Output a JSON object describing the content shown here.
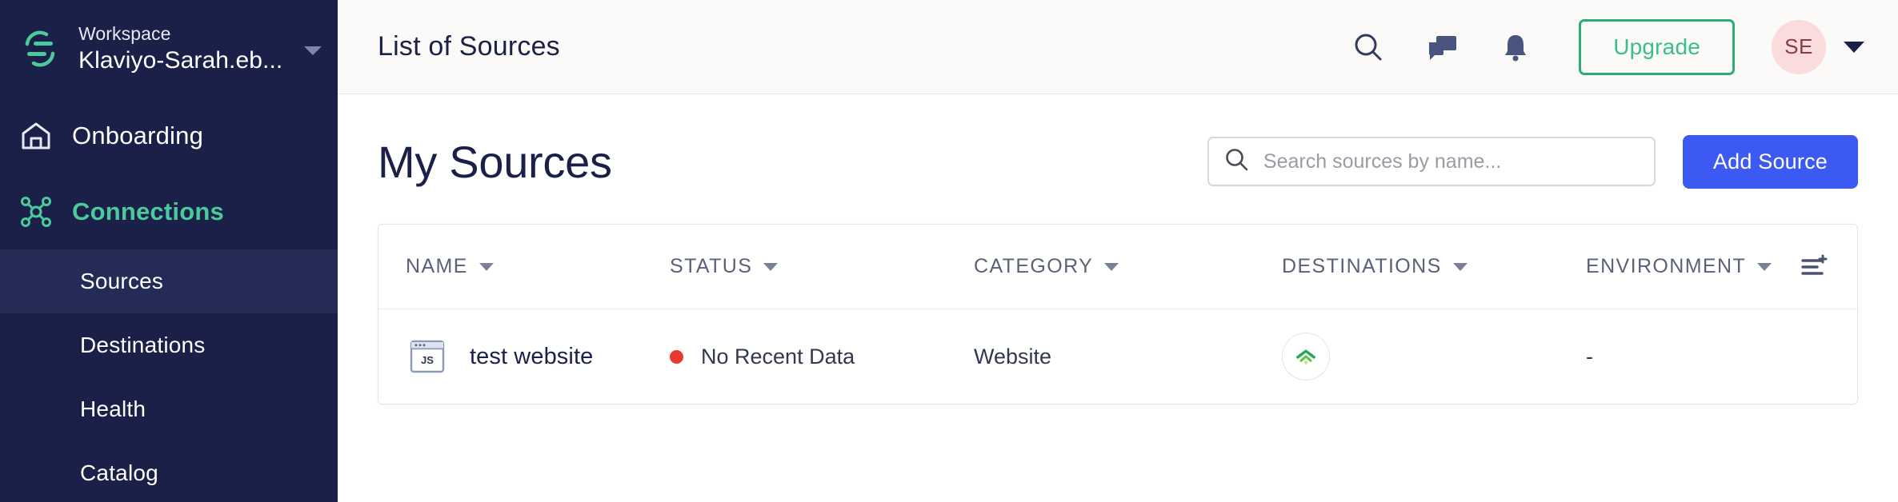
{
  "sidebar": {
    "logo_icon": "segment-logo-icon",
    "workspace_label": "Workspace",
    "workspace_name": "Klaviyo-Sarah.eb...",
    "workspace_caret_icon": "chevron-down-icon",
    "nav": [
      {
        "label": "Onboarding",
        "icon": "home-icon",
        "active": false
      },
      {
        "label": "Connections",
        "icon": "connections-node-icon",
        "active": true
      }
    ],
    "sub_nav": [
      {
        "label": "Sources",
        "active": true
      },
      {
        "label": "Destinations",
        "active": false
      },
      {
        "label": "Health",
        "active": false
      },
      {
        "label": "Catalog",
        "active": false
      }
    ],
    "bg_color": "#1B2049",
    "accent_color": "#4BCA9B"
  },
  "topbar": {
    "title": "List of Sources",
    "icons": [
      {
        "name": "search-icon"
      },
      {
        "name": "chat-feedback-icon"
      },
      {
        "name": "bell-notification-icon"
      }
    ],
    "upgrade_label": "Upgrade",
    "upgrade_color": "#27AE78",
    "avatar_initials": "SE",
    "avatar_bg": "#FADCDC",
    "avatar_caret_icon": "chevron-down-icon",
    "bg_color": "#FBFAF8"
  },
  "main": {
    "page_title": "My Sources",
    "search": {
      "icon": "search-icon",
      "value": "",
      "placeholder": "Search sources by name..."
    },
    "add_source_label": "Add Source",
    "add_source_color": "#3C59F2",
    "table": {
      "columns": [
        {
          "label": "NAME",
          "caret_icon": "caret-down-icon"
        },
        {
          "label": "STATUS",
          "caret_icon": "caret-down-icon"
        },
        {
          "label": "CATEGORY",
          "caret_icon": "caret-down-icon"
        },
        {
          "label": "DESTINATIONS",
          "caret_icon": "caret-down-icon"
        },
        {
          "label": "ENVIRONMENT",
          "caret_icon": "caret-down-icon"
        }
      ],
      "settings_icon": "column-settings-icon",
      "rows": [
        {
          "source_icon": "javascript-website-icon",
          "name": "test website",
          "status": "No Recent Data",
          "status_color": "#E8382F",
          "category": "Website",
          "destination_icon": "wifi-signal-icon",
          "environment": "-"
        }
      ]
    }
  }
}
